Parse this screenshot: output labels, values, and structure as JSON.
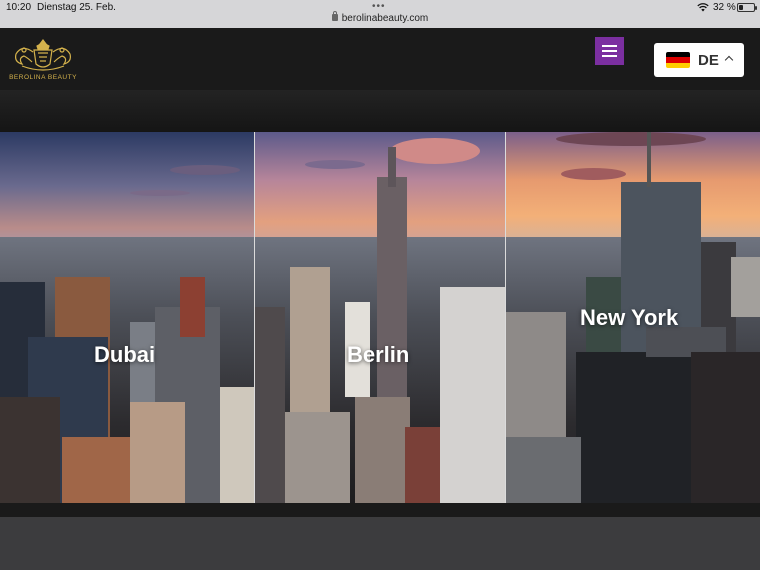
{
  "status_bar": {
    "time": "10:20",
    "date": "Dienstag 25. Feb.",
    "battery_percent": "32 %",
    "battery_level": 0.32,
    "wifi_icon": "wifi-icon",
    "multitask_dots": "•••"
  },
  "browser": {
    "url": "berolinabeauty.com"
  },
  "header": {
    "logo_text": "BEROLINA BEAUTY",
    "menu_icon": "hamburger-menu-icon",
    "language": {
      "code": "DE",
      "flag_icon": "germany-flag-icon"
    }
  },
  "colors": {
    "menu_button": "#7b2fa0",
    "logo_gold": "#d4b24c",
    "header_bg": "#1a1a1a"
  },
  "hero": {
    "panels": [
      {
        "label": "Dubai"
      },
      {
        "label": "Berlin"
      },
      {
        "label": "New York"
      }
    ]
  }
}
